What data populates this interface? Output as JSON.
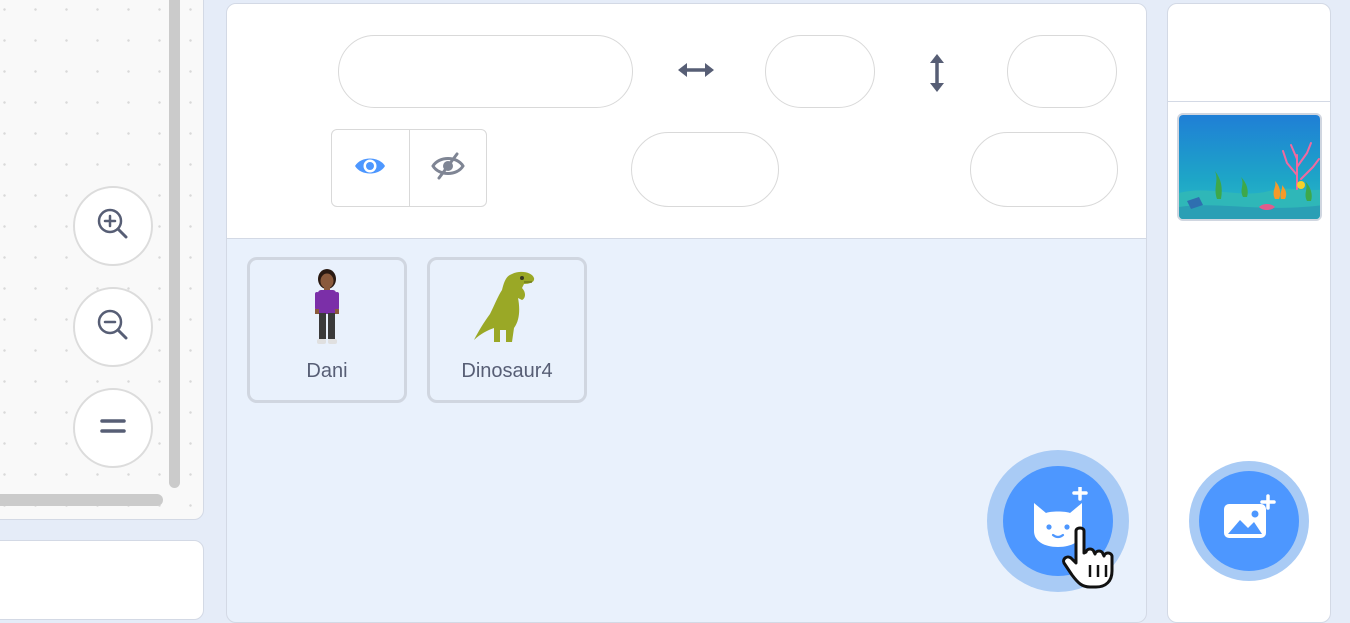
{
  "sprite_info": {
    "name_value": "",
    "x_value": "",
    "y_value": "",
    "size_value": "",
    "direction_value": "",
    "show_visible_label": "show",
    "show_hidden_label": "hide"
  },
  "icons": {
    "zoom_in": "zoom-in-icon",
    "zoom_out": "zoom-out-icon",
    "zoom_reset": "equals-icon",
    "x_arrow": "horizontal-arrow-icon",
    "y_arrow": "vertical-arrow-icon",
    "visible": "eye-icon",
    "hidden": "eye-slash-icon",
    "add_sprite": "cat-plus-icon",
    "add_backdrop": "image-plus-icon",
    "cursor": "hand-pointer-icon"
  },
  "sprites": [
    {
      "name": "Dani"
    },
    {
      "name": "Dinosaur4"
    }
  ],
  "colors": {
    "accent": "#4d97ff",
    "halo": "#a9cbf5",
    "pane_bg": "#e9f1fc",
    "text": "#575e75"
  }
}
